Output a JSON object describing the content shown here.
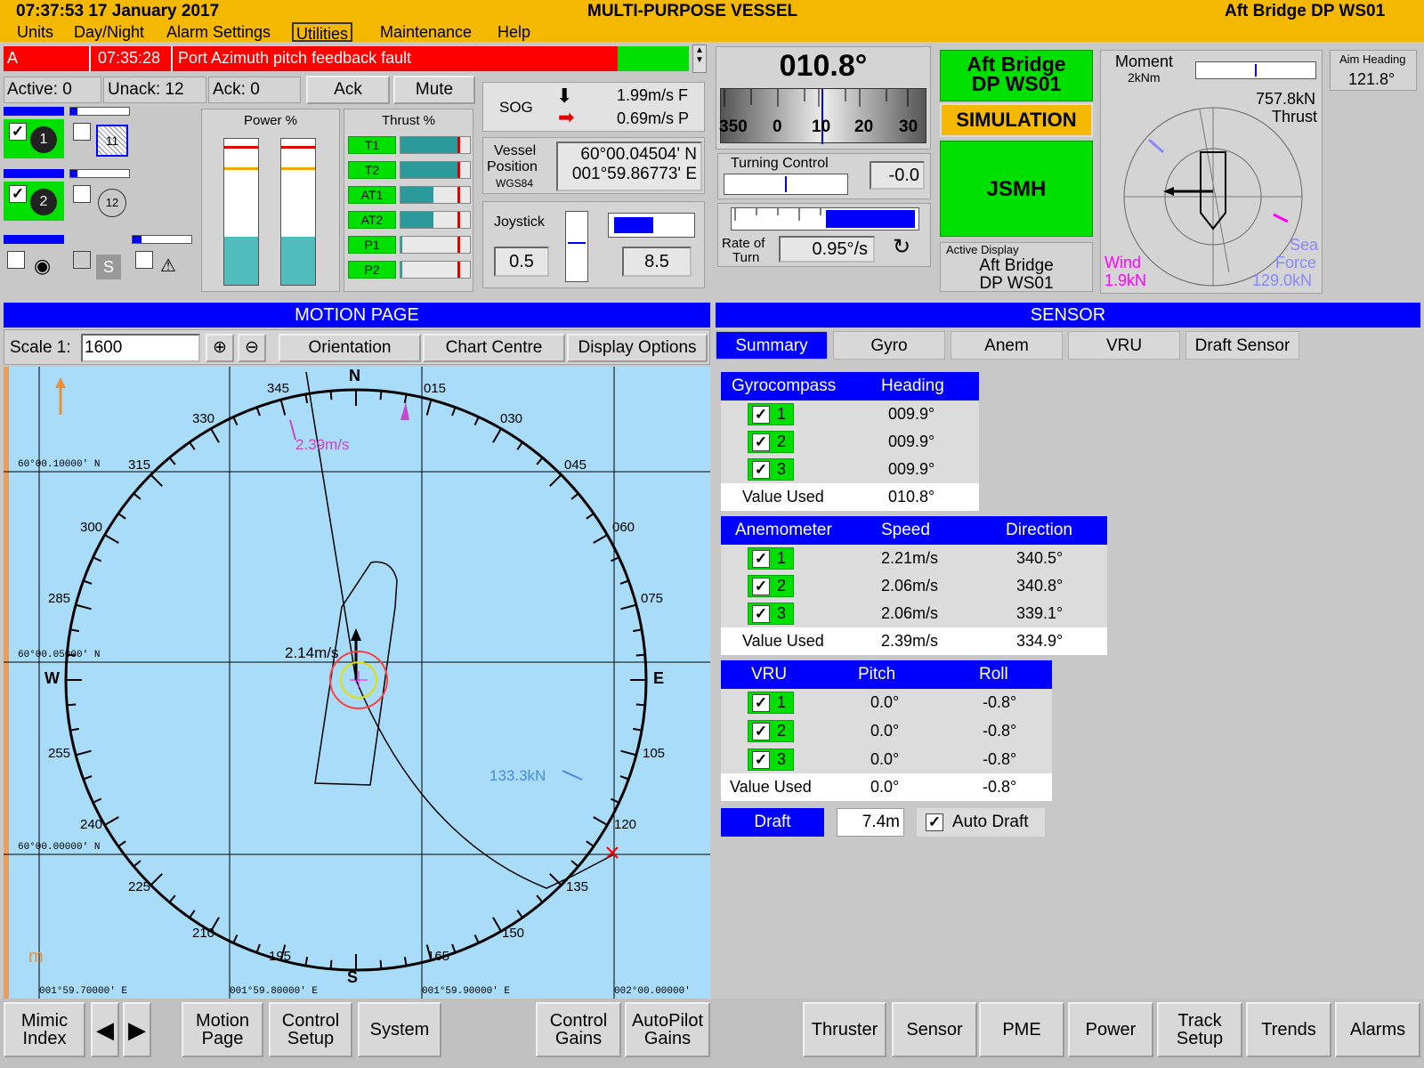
{
  "title": {
    "datetime": "07:37:53 17 January 2017",
    "vessel": "MULTI-PURPOSE VESSEL",
    "station": "Aft Bridge DP WS01"
  },
  "menu": [
    "Units",
    "Day/Night",
    "Alarm Settings",
    "Utilities",
    "Maintenance",
    "Help"
  ],
  "alarm": {
    "code": "A",
    "time": "07:35:28",
    "message": "Port Azimuth pitch feedback fault"
  },
  "alarm_counts": {
    "active": "Active: 0",
    "unack": "Unack: 12",
    "ack": "Ack:  0",
    "ack_button": "Ack",
    "mute_button": "Mute"
  },
  "power": {
    "label": "Power %",
    "bars": [
      0.33,
      0.33
    ]
  },
  "thrust": {
    "label": "Thrust %",
    "items": [
      {
        "name": "T1",
        "fill": 0.82,
        "mark": 0.82
      },
      {
        "name": "T2",
        "fill": 0.82,
        "mark": 0.82
      },
      {
        "name": "AT1",
        "fill": 0.48,
        "mark": 0.82
      },
      {
        "name": "AT2",
        "fill": 0.48,
        "mark": 0.82
      },
      {
        "name": "P1",
        "fill": 0.03,
        "mark": 0.82
      },
      {
        "name": "P2",
        "fill": 0.03,
        "mark": 0.82
      }
    ]
  },
  "sog": {
    "label": "SOG",
    "fwd": "1.99m/s F",
    "port": "0.69m/s P"
  },
  "position": {
    "label1": "Vessel",
    "label2": "Position",
    "datum": "WGS84",
    "lat": "60°00.04504' N",
    "lon": "001°59.86773' E"
  },
  "joystick": {
    "label": "Joystick",
    "left": "0.5",
    "right": "8.5"
  },
  "heading": {
    "value": "010.8°",
    "ticks": [
      "350",
      "0",
      "10",
      "20",
      "30"
    ]
  },
  "turning": {
    "label": "Turning Control",
    "value": "-0.0"
  },
  "rot": {
    "label1": "Rate of",
    "label2": "Turn",
    "value": "0.95°/s"
  },
  "status": {
    "station1": "Aft Bridge",
    "station2": "DP WS01",
    "mode": "SIMULATION",
    "operator": "JSMH",
    "active_display_label": "Active Display",
    "active_display1": "Aft Bridge",
    "active_display2": "DP WS01"
  },
  "moment": {
    "label": "Moment",
    "unit": "2kNm"
  },
  "aim": {
    "label": "Aim Heading",
    "value": "121.8°"
  },
  "forces": {
    "thrust_value": "757.8kN",
    "thrust_label": "Thrust",
    "wind_label": "Wind",
    "wind_value": "1.9kN",
    "sea_label1": "Sea",
    "sea_label2": "Force",
    "sea_value": "129.0kN"
  },
  "motion": {
    "title": "MOTION PAGE",
    "scale_label": "Scale 1:",
    "scale_value": "1600",
    "orientation": "Orientation",
    "chart_centre": "Chart Centre",
    "display_options": "Display Options",
    "compass_labels": {
      "n": "N",
      "s": "S",
      "e": "E",
      "w": "W",
      "d015": "015",
      "d030": "030",
      "d045": "045",
      "d060": "060",
      "d075": "075",
      "d105": "105",
      "d120": "120",
      "d135": "135",
      "d150": "150",
      "d165": "165",
      "d195": "195",
      "d210": "210",
      "d225": "225",
      "d240": "240",
      "d255": "255",
      "d285": "285",
      "d300": "300",
      "d315": "315",
      "d330": "330",
      "d345": "345"
    },
    "lat1": "60°00.10000' N",
    "lat2": "60°00.05000' N",
    "lat3": "60°00.00000' N",
    "lon1": "001°59.70000' E",
    "lon2": "001°59.80000' E",
    "lon3": "001°59.90000' E",
    "lon4": "002°00.00000'",
    "wind_speed": "2.39m/s",
    "vessel_speed": "2.14m/s",
    "current": "133.3kN",
    "unit": "m"
  },
  "sensor": {
    "title": "SENSOR",
    "tabs": [
      "Summary",
      "Gyro",
      "Anem",
      "VRU",
      "Draft Sensor"
    ],
    "gyro": {
      "h1": "Gyrocompass",
      "h2": "Heading",
      "rows": [
        {
          "n": "1",
          "v": "009.9°"
        },
        {
          "n": "2",
          "v": "009.9°"
        },
        {
          "n": "3",
          "v": "009.9°"
        }
      ],
      "used_label": "Value Used",
      "used": "010.8°"
    },
    "anem": {
      "h1": "Anemometer",
      "h2": "Speed",
      "h3": "Direction",
      "rows": [
        {
          "n": "1",
          "s": "2.21m/s",
          "d": "340.5°"
        },
        {
          "n": "2",
          "s": "2.06m/s",
          "d": "340.8°"
        },
        {
          "n": "3",
          "s": "2.06m/s",
          "d": "339.1°"
        }
      ],
      "used_label": "Value Used",
      "used_s": "2.39m/s",
      "used_d": "334.9°"
    },
    "vru": {
      "h1": "VRU",
      "h2": "Pitch",
      "h3": "Roll",
      "rows": [
        {
          "n": "1",
          "p": "0.0°",
          "r": "-0.8°"
        },
        {
          "n": "2",
          "p": "0.0°",
          "r": "-0.8°"
        },
        {
          "n": "3",
          "p": "0.0°",
          "r": "-0.8°"
        }
      ],
      "used_label": "Value Used",
      "used_p": "0.0°",
      "used_r": "-0.8°"
    },
    "draft": {
      "label": "Draft",
      "value": "7.4m",
      "auto": "Auto Draft"
    }
  },
  "bottom": {
    "mimic": [
      "Mimic",
      "Index"
    ],
    "motion": [
      "Motion",
      "Page"
    ],
    "control": [
      "Control",
      "Setup"
    ],
    "system": "System",
    "gains": [
      "Control",
      "Gains"
    ],
    "autopilot": [
      "AutoPilot",
      "Gains"
    ],
    "thruster": "Thruster",
    "sensor": "Sensor",
    "pme": "PME",
    "power": "Power",
    "track": [
      "Track",
      "Setup"
    ],
    "trends": "Trends",
    "alarms": "Alarms"
  },
  "colors": {
    "accent": "#0000ff",
    "titlebar": "#f5b800",
    "alarm": "#ff0000",
    "ok": "#00e000",
    "sea": "#a8dcf8"
  }
}
